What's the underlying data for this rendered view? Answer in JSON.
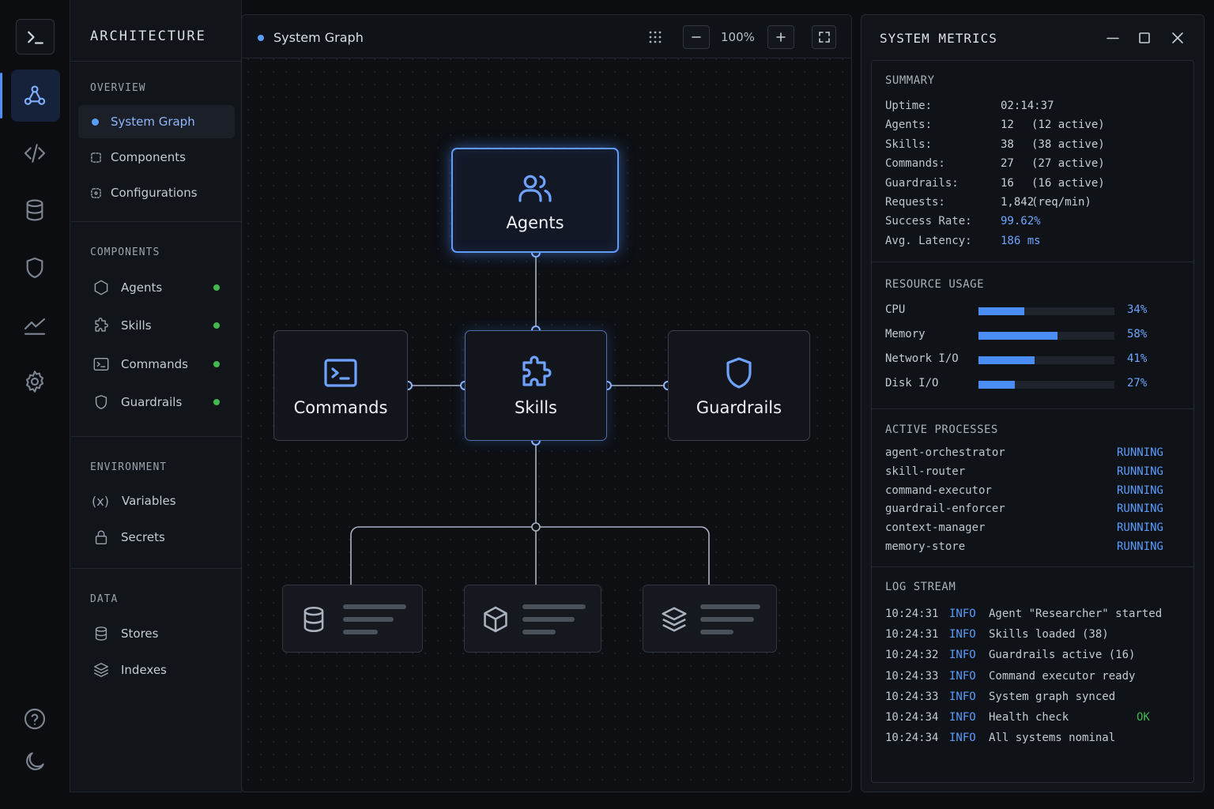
{
  "sidebar": {
    "title": "ARCHITECTURE",
    "overview": {
      "heading": "OVERVIEW",
      "items": [
        {
          "label": "System Graph"
        },
        {
          "label": "Components"
        },
        {
          "label": "Configurations"
        }
      ]
    },
    "components": {
      "heading": "COMPONENTS",
      "items": [
        {
          "label": "Agents",
          "icon": "hexagon-icon",
          "status_color": "#3fb950"
        },
        {
          "label": "Skills",
          "icon": "puzzle-icon",
          "status_color": "#3fb950"
        },
        {
          "label": "Commands",
          "icon": "terminal-icon",
          "status_color": "#3fb950"
        },
        {
          "label": "Guardrails",
          "icon": "shield-icon",
          "status_color": "#3fb950"
        }
      ]
    },
    "environment": {
      "heading": "ENVIRONMENT",
      "items": [
        {
          "label": "Variables",
          "glyph": "(x)"
        },
        {
          "label": "Secrets",
          "icon": "lock-icon"
        }
      ]
    },
    "data": {
      "heading": "DATA",
      "items": [
        {
          "label": "Stores",
          "icon": "database-icon"
        },
        {
          "label": "Indexes",
          "icon": "layers-icon"
        }
      ]
    }
  },
  "graph": {
    "title": "System Graph",
    "zoom": "100%",
    "nodes": {
      "agents": "Agents",
      "commands": "Commands",
      "skills": "Skills",
      "guardrails": "Guardrails"
    },
    "leaves": [
      "database-icon",
      "cube-icon",
      "layers-icon"
    ]
  },
  "metrics": {
    "title": "SYSTEM METRICS",
    "summary": {
      "heading": "SUMMARY",
      "rows": [
        {
          "key": "Uptime:",
          "value": "02:14:37",
          "extra": ""
        },
        {
          "key": "Agents:",
          "value": "12",
          "extra": "(12 active)"
        },
        {
          "key": "Skills:",
          "value": "38",
          "extra": "(38 active)"
        },
        {
          "key": "Commands:",
          "value": "27",
          "extra": "(27 active)"
        },
        {
          "key": "Guardrails:",
          "value": "16",
          "extra": "(16 active)"
        },
        {
          "key": "Requests:",
          "value": "1,842",
          "extra": "(req/min)"
        },
        {
          "key": "Success Rate:",
          "value": "99.62%",
          "extra": ""
        },
        {
          "key": "Avg. Latency:",
          "value": "186 ms",
          "extra": ""
        }
      ]
    },
    "resources": {
      "heading": "RESOURCE USAGE",
      "items": [
        {
          "label": "CPU",
          "value": 0.34,
          "pct": "34%"
        },
        {
          "label": "Memory",
          "value": 0.58,
          "pct": "58%"
        },
        {
          "label": "Network I/O",
          "value": 0.41,
          "pct": "41%"
        },
        {
          "label": "Disk I/O",
          "value": 0.27,
          "pct": "27%"
        }
      ]
    },
    "processes": {
      "heading": "ACTIVE PROCESSES",
      "items": [
        {
          "name": "agent-orchestrator",
          "status": "RUNNING"
        },
        {
          "name": "skill-router",
          "status": "RUNNING"
        },
        {
          "name": "command-executor",
          "status": "RUNNING"
        },
        {
          "name": "guardrail-enforcer",
          "status": "RUNNING"
        },
        {
          "name": "context-manager",
          "status": "RUNNING"
        },
        {
          "name": "memory-store",
          "status": "RUNNING"
        }
      ]
    },
    "logs": {
      "heading": "LOG STREAM",
      "items": [
        {
          "time": "10:24:31",
          "level": "INFO",
          "msg": "Agent \"Researcher\" started",
          "tag": ""
        },
        {
          "time": "10:24:31",
          "level": "INFO",
          "msg": "Skills loaded (38)",
          "tag": ""
        },
        {
          "time": "10:24:32",
          "level": "INFO",
          "msg": "Guardrails active (16)",
          "tag": ""
        },
        {
          "time": "10:24:33",
          "level": "INFO",
          "msg": "Command executor ready",
          "tag": ""
        },
        {
          "time": "10:24:33",
          "level": "INFO",
          "msg": "System graph synced",
          "tag": ""
        },
        {
          "time": "10:24:34",
          "level": "INFO",
          "msg": "Health check",
          "tag": "OK"
        },
        {
          "time": "10:24:34",
          "level": "INFO",
          "msg": "All systems nominal",
          "tag": ""
        }
      ]
    }
  },
  "colors": {
    "accent": "#5b9dfa",
    "status_ok": "#3fb950",
    "background": "#0b0d11"
  }
}
